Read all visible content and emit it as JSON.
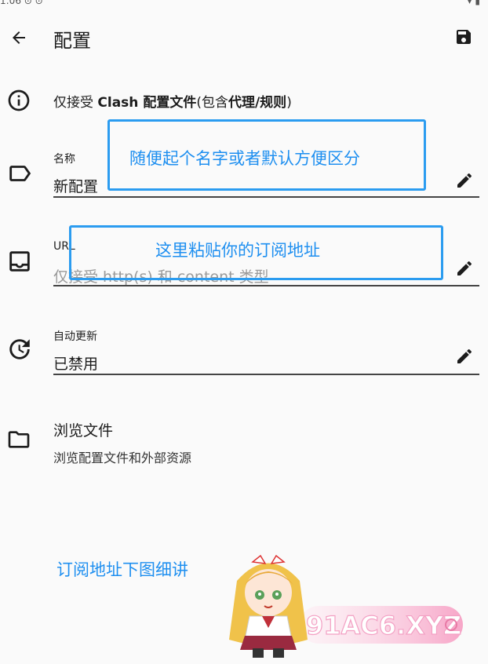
{
  "statusbar": {
    "left": "1:06 ⊙ ⊙",
    "right": "▾ ▮"
  },
  "appbar": {
    "title": "配置"
  },
  "info": {
    "pre": "仅接受 ",
    "b1": "Clash 配置文件",
    "mid": "(包含",
    "b2": "代理/规则",
    "post": ")"
  },
  "fields": {
    "name": {
      "label": "名称",
      "value": "新配置"
    },
    "url": {
      "label": "URL",
      "placeholder": "仅接受 http(s) 和 content 类型"
    },
    "auto_update": {
      "label": "自动更新",
      "value": "已禁用"
    }
  },
  "browse": {
    "title": "浏览文件",
    "subtitle": "浏览配置文件和外部资源"
  },
  "annotations": {
    "name_hint": "随便起个名字或者默认方便区分",
    "url_hint": "这里粘贴你的订阅地址",
    "footer": "订阅地址下图细讲"
  },
  "watermark": {
    "text": "91AC6.XYZ"
  },
  "colors": {
    "accent": "#1e8ff0",
    "callout_border": "#2b9cf0",
    "background": "#fafafa"
  }
}
